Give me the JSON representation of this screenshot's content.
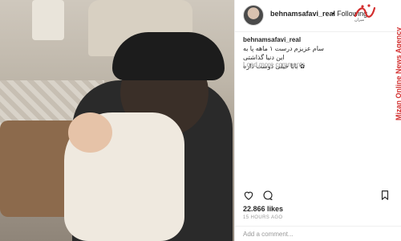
{
  "post": {
    "username": "behnamsafavi_real",
    "follow_dot": "•",
    "follow_label": "Following",
    "caption_user": "behnamsafavi_real",
    "caption_lines": [
      "سام عزیزم درست ۱ ماهه پا به",
      "این دنیا گذاشتی",
      "✿ بابا خیلی دوست داره"
    ],
    "load_more": "Load more comments",
    "likes": "22.866 likes",
    "time": "15 HOURS AGO",
    "comment_placeholder": "Add a comment..."
  },
  "watermark": {
    "logo_text": "میزان",
    "vertical_text": "Mizan Online News Agency",
    "color": "#d32f2f"
  },
  "icons": [
    "heart-icon",
    "comment-icon",
    "bookmark-icon"
  ]
}
